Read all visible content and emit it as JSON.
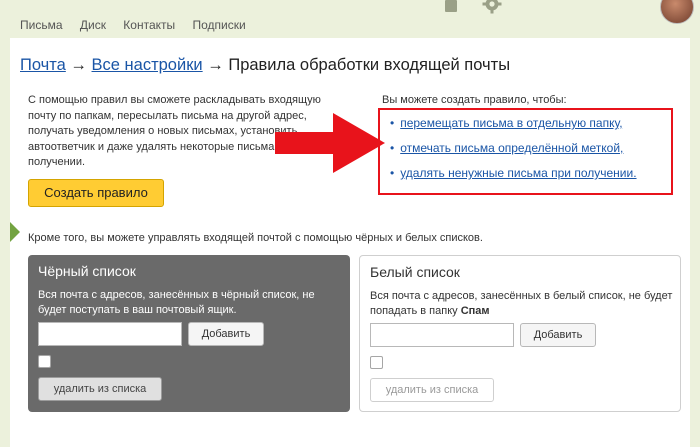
{
  "top_nav": {
    "items": [
      {
        "label": "Письма"
      },
      {
        "label": "Диск"
      },
      {
        "label": "Контакты"
      },
      {
        "label": "Подписки"
      }
    ]
  },
  "breadcrumb": {
    "mail": "Почта",
    "sep1": "→",
    "all_settings": "Все настройки",
    "sep2": "→",
    "current": "Правила обработки входящей почты"
  },
  "intro": {
    "text": "С помощью правил вы сможете раскладывать входящую почту по папкам, пересылать письма на другой адрес, получать уведомления о новых письмах, установить автоответчик и даже удалять некоторые письма при получении."
  },
  "create_button": "Создать правило",
  "rules": {
    "heading": "Вы можете создать правило, чтобы:",
    "items": [
      "перемещать письма в отдельную папку,",
      "отмечать письма определённой меткой,",
      "удалять ненужные письма при получении."
    ],
    "highlight_color": "#e8131b"
  },
  "lists_note": "Кроме того, вы можете управлять входящей почтой с помощью чёрных и белых списков.",
  "blacklist": {
    "title": "Чёрный список",
    "description": "Вся почта с адресов, занесённых в чёрный список, не будет поступать в ваш почтовый ящик.",
    "input_value": "",
    "add_label": "Добавить",
    "remove_label": "удалить из списка"
  },
  "whitelist": {
    "title": "Белый список",
    "description_prefix": "Вся почта с адресов, занесённых в белый список, не будет попадать в папку ",
    "description_bold": "Спам",
    "input_value": "",
    "add_label": "Добавить",
    "remove_label": "удалить из списка"
  },
  "colors": {
    "accent_button": "#ffcc33",
    "link": "#1a55a6",
    "arrow": "#e8131b",
    "blacklist_panel": "#6a6a6a"
  }
}
